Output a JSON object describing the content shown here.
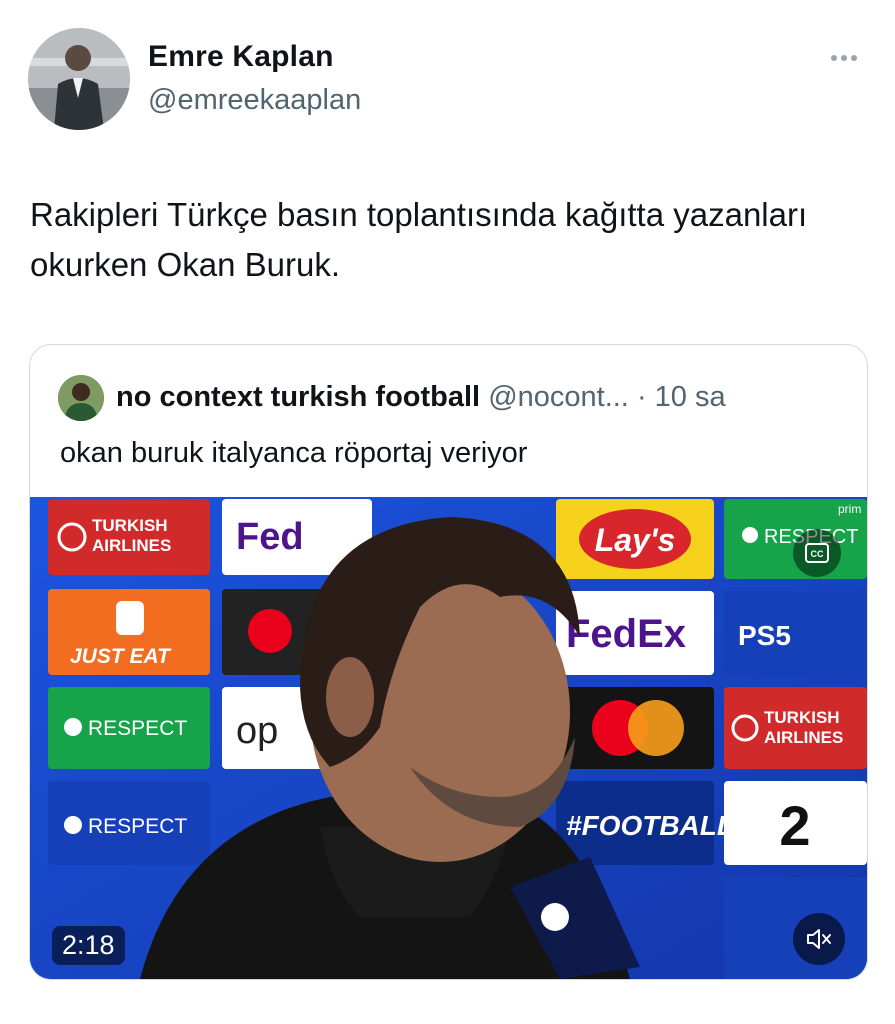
{
  "tweet": {
    "author": {
      "name": "Emre Kaplan",
      "handle": "@emreekaaplan"
    },
    "text": "Rakipleri Türkçe basın toplantısında kağıtta yazanları okurken Okan Buruk."
  },
  "quote": {
    "author": {
      "name": "no context turkish football",
      "handle": "@nocont...",
      "separator": "·",
      "time": "10 sa"
    },
    "text": "okan buruk italyanca röportaj veriyor",
    "video": {
      "duration": "2:18",
      "sponsor_boards": {
        "turkish_airlines": "TURKISH AIRLINES",
        "turkish_airlines_line1": "TURKISH",
        "turkish_airlines_line2": "AIRLINES",
        "fedex": "FedEx",
        "fedex_partial": "Fed",
        "lays": "Lay's",
        "respect": "RESPECT",
        "just_eat": "JUST EAT",
        "ps5": "PS5",
        "football": "#FOOTBALL",
        "op": "op",
        "two": "2",
        "prime": "prim"
      }
    }
  },
  "colors": {
    "accent_blue": "#1d9bf0",
    "board_blue": "#1a4bd3",
    "text": "#0f1419",
    "muted": "#536471"
  },
  "icons": [
    "more-icon",
    "captions-icon",
    "mute-icon"
  ]
}
